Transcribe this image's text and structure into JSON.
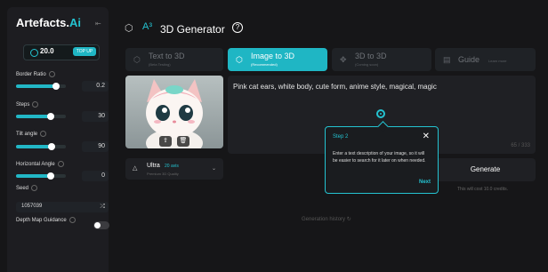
{
  "sidebar": {
    "brand_main": "Artefacts.",
    "brand_accent": "Ai",
    "credits": "20.0",
    "top_up": "TOP UP",
    "params": {
      "border_ratio": {
        "label": "Border Ratio",
        "value": "0.2",
        "fill_fraction": 0.8
      },
      "steps": {
        "label": "Steps",
        "value": "30",
        "fill_fraction": 0.7
      },
      "tilt_angle": {
        "label": "Tilt angle",
        "value": "90",
        "fill_fraction": 0.72
      },
      "horizontal_angle": {
        "label": "Horizontal Angle",
        "value": "0",
        "fill_fraction": 0.7
      }
    },
    "seed": {
      "label": "Seed",
      "value": "1057039"
    },
    "depth_map": {
      "label": "Depth Map Guidance",
      "enabled": false
    }
  },
  "header": {
    "title_prefix": "A³",
    "title": "3D Generator",
    "help": "?"
  },
  "tabs": [
    {
      "label": "Text to 3D",
      "sub": "(Beta Testing)"
    },
    {
      "label": "Image to 3D",
      "sub": "(Recommended)"
    },
    {
      "label": "3D to 3D",
      "sub": "(Coming soon)"
    },
    {
      "label": "Guide",
      "sub": "Learn more"
    }
  ],
  "prompt": {
    "text": "Pink cat ears, white body, cute form, anime style, magical, magic",
    "char_count": "65 / 333"
  },
  "model": {
    "name": "Ultra",
    "credits": "20 avis",
    "sub": "Premium 3D Quality"
  },
  "generate": {
    "label": "Generate",
    "cost": "This will cost 10.0 credits."
  },
  "history": "Generation history",
  "tooltip": {
    "step": "Step 2",
    "body": "Enter a text description of your image, so it will be easier to search for it later on when needed.",
    "next": "Next",
    "close": "✕"
  },
  "colors": {
    "accent": "#1fb6c4",
    "background": "#161618"
  }
}
